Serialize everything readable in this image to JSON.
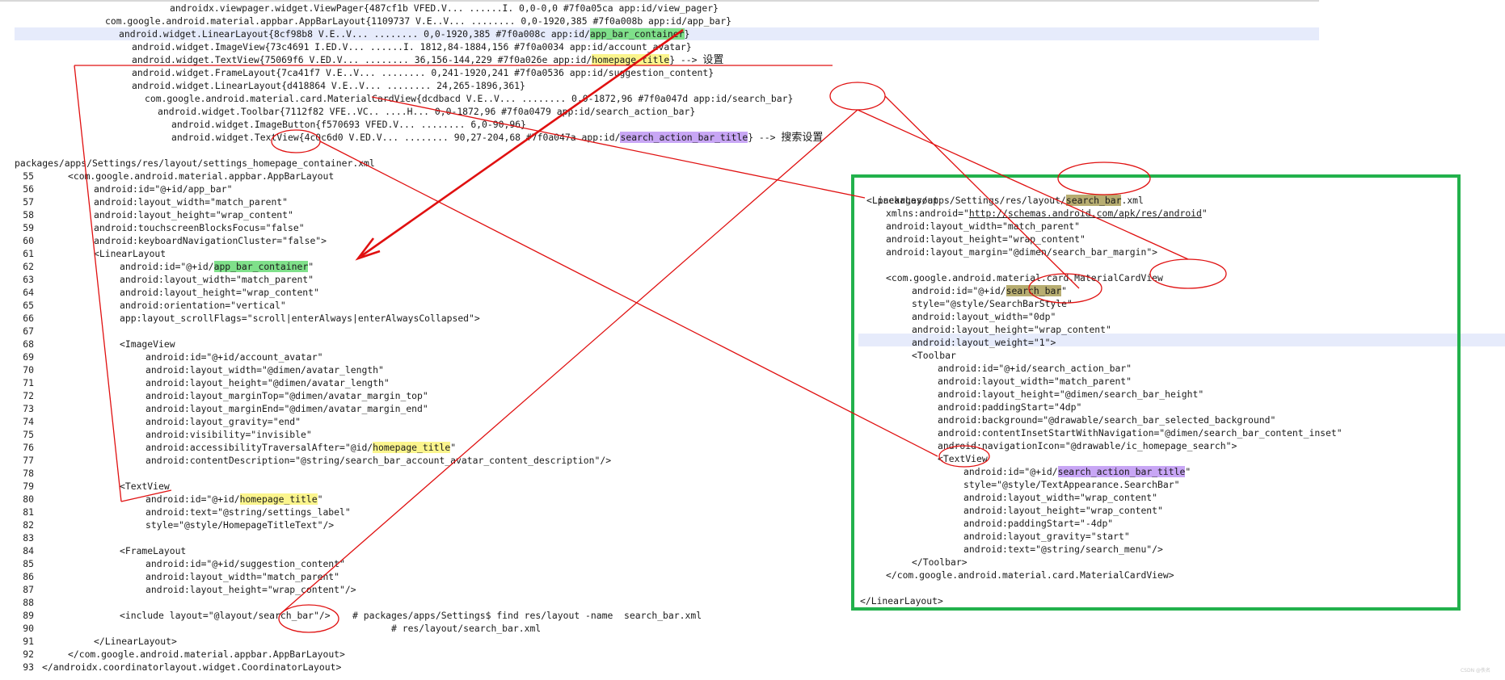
{
  "hierarchy_dump": {
    "lines": [
      {
        "text": "androidx.viewpager.widget.ViewPager{487cf1b VFED.V... ......I. 0,0-0,0 #7f0a05ca app:id/view_pager}"
      },
      {
        "text": "com.google.android.material.appbar.AppBarLayout{1109737 V.E..V... ........ 0,0-1920,385 #7f0a008b app:id/app_bar}"
      },
      {
        "pre": "android.widget.LinearLayout{8cf98b8 V.E..V... ........ 0,0-1920,385 #7f0a008c app:id/",
        "hl": "app_bar_container",
        "post": "}"
      },
      {
        "text": "android.widget.ImageView{73c4691 I.ED.V... ......I. 1812,84-1884,156 #7f0a0034 app:id/account_avatar}"
      },
      {
        "pre": "android.widget.TextView{75069f6 V.ED.V... ........ 36,156-144,229 #7f0a026e app:id/",
        "hl": "homepage_title",
        "post": "} --> "
      },
      {
        "text": "android.widget.FrameLayout{7ca41f7 V.E..V... ........ 0,241-1920,241 #7f0a0536 app:id/suggestion_content}"
      },
      {
        "text": "android.widget.LinearLayout{d418864 V.E..V... ........ 24,265-1896,361}"
      },
      {
        "text": "com.google.android.material.card.MaterialCardView{dcdbacd V.E..V... ........ 0,0-1872,96 #7f0a047d app:id/search_bar}"
      },
      {
        "text": "android.widget.Toolbar{7112f82 VFE..VC.. ....H... 0,0-1872,96 #7f0a0479 app:id/search_action_bar}"
      },
      {
        "text": "android.widget.ImageButton{f570693 VFED.V... ........ 6,0-90,96}"
      },
      {
        "pre": "android.widget.TextView{4c0c6d0 V.ED.V... ........ 90,27-204,68 #7f0a047a app:id/",
        "hl": "search_action_bar_title",
        "post": "} --> "
      }
    ],
    "note_settings": "设置",
    "note_search_settings": "搜索设置"
  },
  "container_xml": {
    "path": "packages/apps/Settings/res/layout/settings_homepage_container.xml",
    "lines": [
      {
        "n": "55",
        "text": "<com.google.android.material.appbar.AppBarLayout"
      },
      {
        "n": "56",
        "text": "android:id=\"@+id/app_bar\""
      },
      {
        "n": "57",
        "text": "android:layout_width=\"match_parent\""
      },
      {
        "n": "58",
        "text": "android:layout_height=\"wrap_content\""
      },
      {
        "n": "59",
        "text": "android:touchscreenBlocksFocus=\"false\""
      },
      {
        "n": "60",
        "text": "android:keyboardNavigationCluster=\"false\">"
      },
      {
        "n": "61",
        "text": "<LinearLayout"
      },
      {
        "n": "62",
        "pre": "android:id=\"@+id/",
        "hl": "app_bar_container",
        "post": "\""
      },
      {
        "n": "63",
        "text": "android:layout_width=\"match_parent\""
      },
      {
        "n": "64",
        "text": "android:layout_height=\"wrap_content\""
      },
      {
        "n": "65",
        "text": "android:orientation=\"vertical\""
      },
      {
        "n": "66",
        "text": "app:layout_scrollFlags=\"scroll|enterAlways|enterAlwaysCollapsed\">"
      },
      {
        "n": "67",
        "text": ""
      },
      {
        "n": "68",
        "text": "<ImageView"
      },
      {
        "n": "69",
        "text": "android:id=\"@+id/account_avatar\""
      },
      {
        "n": "70",
        "text": "android:layout_width=\"@dimen/avatar_length\""
      },
      {
        "n": "71",
        "text": "android:layout_height=\"@dimen/avatar_length\""
      },
      {
        "n": "72",
        "text": "android:layout_marginTop=\"@dimen/avatar_margin_top\""
      },
      {
        "n": "73",
        "text": "android:layout_marginEnd=\"@dimen/avatar_margin_end\""
      },
      {
        "n": "74",
        "text": "android:layout_gravity=\"end\""
      },
      {
        "n": "75",
        "text": "android:visibility=\"invisible\""
      },
      {
        "n": "76",
        "pre": "android:accessibilityTraversalAfter=\"@id/",
        "hl": "homepage_title",
        "post": "\""
      },
      {
        "n": "77",
        "text": "android:contentDescription=\"@string/search_bar_account_avatar_content_description\"/>"
      },
      {
        "n": "78",
        "text": ""
      },
      {
        "n": "79",
        "text": "<TextView"
      },
      {
        "n": "80",
        "pre": "android:id=\"@+id/",
        "hl": "homepage_title",
        "post": "\""
      },
      {
        "n": "81",
        "text": "android:text=\"@string/settings_label\""
      },
      {
        "n": "82",
        "text": "style=\"@style/HomepageTitleText\"/>"
      },
      {
        "n": "83",
        "text": ""
      },
      {
        "n": "84",
        "text": "<FrameLayout"
      },
      {
        "n": "85",
        "text": "android:id=\"@+id/suggestion_content\""
      },
      {
        "n": "86",
        "text": "android:layout_width=\"match_parent\""
      },
      {
        "n": "87",
        "text": "android:layout_height=\"wrap_content\"/>"
      },
      {
        "n": "88",
        "text": ""
      },
      {
        "n": "89",
        "text": "<include layout=\"@layout/search_bar\"/>    # packages/apps/Settings$ find res/layout -name  search_bar.xml"
      },
      {
        "n": "90",
        "text": "# res/layout/search_bar.xml"
      },
      {
        "n": "91",
        "text": "</LinearLayout>"
      },
      {
        "n": "92",
        "text": "</com.google.android.material.appbar.AppBarLayout>"
      },
      {
        "n": "93",
        "text": "</androidx.coordinatorlayout.widget.CoordinatorLayout>"
      }
    ]
  },
  "search_bar_xml": {
    "path_pre": "packages/apps/Settings/res/layout/",
    "path_hl": "search_bar",
    "path_post": ".xml",
    "lines": [
      {
        "text": "<LinearLayout"
      },
      {
        "text": "xmlns:android=\"",
        "link": "http://schemas.android.com/apk/res/android",
        "post": "\""
      },
      {
        "text": "android:layout_width=\"match_parent\""
      },
      {
        "text": "android:layout_height=\"wrap_content\""
      },
      {
        "text": "android:layout_margin=\"@dimen/search_bar_margin\">"
      },
      {
        "text": ""
      },
      {
        "text": "<com.google.android.material.card.MaterialCardView"
      },
      {
        "pre": "android:id=\"@+id/",
        "hl": "search_bar",
        "post": "\""
      },
      {
        "text": "style=\"@style/SearchBarStyle\""
      },
      {
        "text": "android:layout_width=\"0dp\""
      },
      {
        "text": "android:layout_height=\"wrap_content\""
      },
      {
        "text": "android:layout_weight=\"1\">"
      },
      {
        "text": "<Toolbar"
      },
      {
        "text": "android:id=\"@+id/search_action_bar\""
      },
      {
        "text": "android:layout_width=\"match_parent\""
      },
      {
        "text": "android:layout_height=\"@dimen/search_bar_height\""
      },
      {
        "text": "android:paddingStart=\"4dp\""
      },
      {
        "text": "android:background=\"@drawable/search_bar_selected_background\""
      },
      {
        "text": "android:contentInsetStartWithNavigation=\"@dimen/search_bar_content_inset\""
      },
      {
        "text": "android:navigationIcon=\"@drawable/ic_homepage_search\">"
      },
      {
        "text": "<TextView"
      },
      {
        "pre": "android:id=\"@+id/",
        "hl": "search_action_bar_title",
        "post": "\""
      },
      {
        "text": "style=\"@style/TextAppearance.SearchBar\""
      },
      {
        "text": "android:layout_width=\"wrap_content\""
      },
      {
        "text": "android:layout_height=\"wrap_content\""
      },
      {
        "text": "android:paddingStart=\"-4dp\""
      },
      {
        "text": "android:layout_gravity=\"start\""
      },
      {
        "text": "android:text=\"@string/search_menu\"/>"
      },
      {
        "text": "</Toolbar>"
      },
      {
        "text": "</com.google.android.material.card.MaterialCardView>"
      },
      {
        "text": ""
      },
      {
        "text": "</LinearLayout>"
      }
    ]
  },
  "colors": {
    "highlight_green": "#7fe08a",
    "highlight_yellow": "#fbf58d",
    "highlight_purple": "#c8a6f5",
    "highlight_olive": "#b7ad71",
    "annotation_red": "#e01010",
    "box_green": "#22b14c"
  },
  "watermark": "CSDN @佚名"
}
